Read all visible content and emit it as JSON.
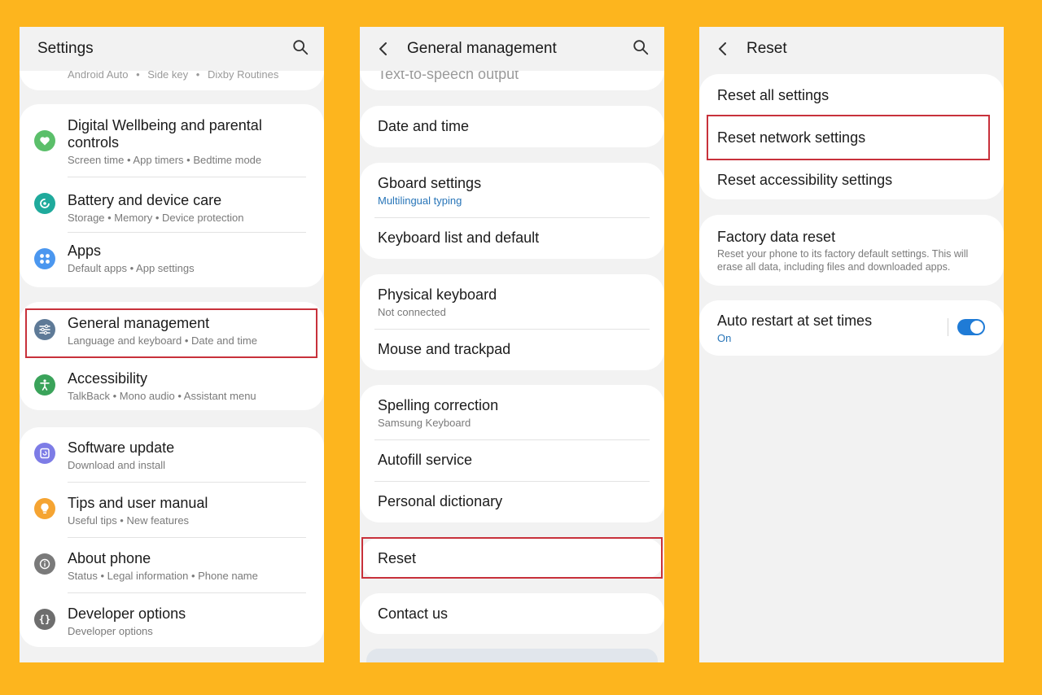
{
  "panel1": {
    "title": "Settings",
    "partial_top": [
      "Android Auto",
      "Side key",
      "Dixby Routines"
    ],
    "items": [
      {
        "title": "Digital Wellbeing and parental controls",
        "title_line1": "Digital Wellbeing and parental",
        "title_line2": "controls",
        "subtitle": "Screen time  •  App timers  •  Bedtime mode",
        "icon": "wellbeing-icon",
        "color": "#5BBF6A"
      },
      {
        "title": "Battery and device care",
        "subtitle": "Storage  •  Memory  •  Device protection",
        "icon": "battery-care-icon",
        "color": "#1FAA9C"
      },
      {
        "title": "Apps",
        "subtitle": "Default apps  •  App settings",
        "icon": "apps-icon",
        "color": "#4B97EF"
      },
      {
        "title": "General management",
        "subtitle": "Language and keyboard  •  Date and time",
        "icon": "sliders-icon",
        "color": "#5E7A97"
      },
      {
        "title": "Accessibility",
        "subtitle": "TalkBack  •  Mono audio  •  Assistant menu",
        "icon": "accessibility-icon",
        "color": "#3AA35A"
      },
      {
        "title": "Software update",
        "subtitle": "Download and install",
        "icon": "software-update-icon",
        "color": "#7D7CE6"
      },
      {
        "title": "Tips and user manual",
        "subtitle": "Useful tips  •  New features",
        "icon": "lightbulb-icon",
        "color": "#F5A432"
      },
      {
        "title": "About phone",
        "subtitle": "Status  •  Legal information  •  Phone name",
        "icon": "info-icon",
        "color": "#7A7A7A"
      },
      {
        "title": "Developer options",
        "subtitle": "Developer options",
        "icon": "braces-icon",
        "color": "#6E6E6E"
      }
    ]
  },
  "panel2": {
    "title": "General management",
    "partial_top": "Text-to-speech output",
    "items": [
      {
        "title": "Date and time"
      },
      {
        "title": "Gboard settings",
        "subtitle": "Multilingual typing"
      },
      {
        "title": "Keyboard list and default"
      },
      {
        "title": "Physical keyboard",
        "subtitle": "Not connected"
      },
      {
        "title": "Mouse and trackpad"
      },
      {
        "title": "Spelling correction",
        "subtitle": "Samsung Keyboard"
      },
      {
        "title": "Autofill service"
      },
      {
        "title": "Personal dictionary"
      },
      {
        "title": "Reset"
      },
      {
        "title": "Contact us"
      }
    ]
  },
  "panel3": {
    "title": "Reset",
    "items": [
      {
        "title": "Reset all settings"
      },
      {
        "title": "Reset network settings"
      },
      {
        "title": "Reset accessibility settings"
      },
      {
        "title": "Factory data reset",
        "subtitle_line1": "Reset your phone to its factory default settings. This will",
        "subtitle_line2": "erase all data, including files and downloaded apps."
      },
      {
        "title": "Auto restart at set times",
        "subtitle": "On",
        "toggle_on": true
      }
    ]
  },
  "colors": {
    "background": "#FDB51E",
    "highlight": "#C8313B",
    "accent_blue": "#1F7BD6"
  }
}
